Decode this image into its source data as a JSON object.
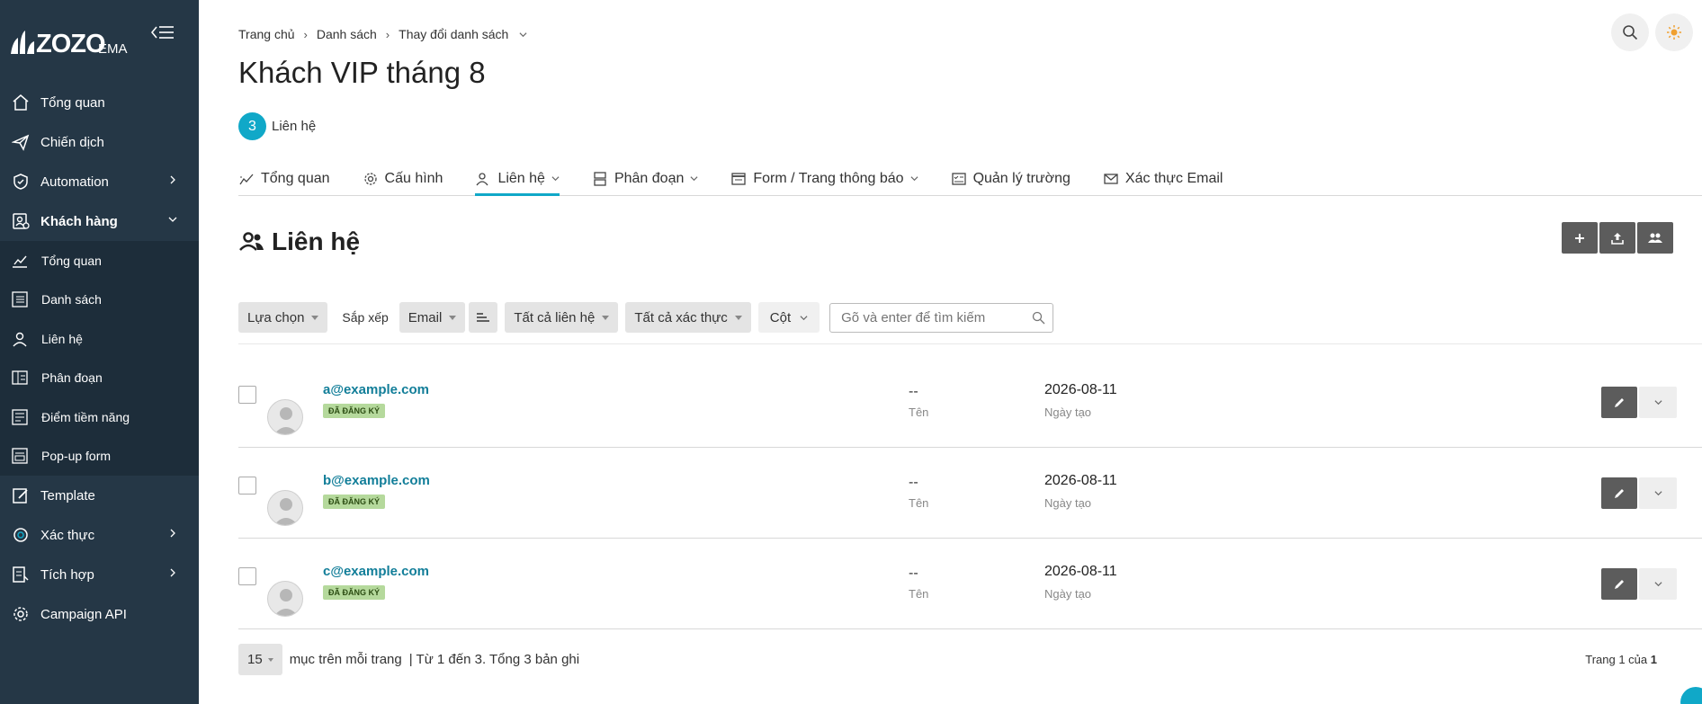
{
  "app": {
    "logo_text": "ZOZO",
    "logo_sub": "EMA"
  },
  "sidebar": {
    "items": [
      {
        "label": "Tổng quan",
        "icon": "home-icon"
      },
      {
        "label": "Chiến dịch",
        "icon": "send-icon"
      },
      {
        "label": "Automation",
        "icon": "shield-check-icon"
      },
      {
        "label": "Khách hàng",
        "icon": "contacts-icon"
      }
    ],
    "sub_items": [
      {
        "label": "Tổng quan",
        "icon": "chart-line-icon"
      },
      {
        "label": "Danh sách",
        "icon": "list-icon"
      },
      {
        "label": "Liên hệ",
        "icon": "user-icon"
      },
      {
        "label": "Phân đoạn",
        "icon": "segment-icon"
      },
      {
        "label": "Điểm tiềm năng",
        "icon": "score-icon"
      },
      {
        "label": "Pop-up form",
        "icon": "form-icon"
      }
    ],
    "bottom_items": [
      {
        "label": "Template",
        "icon": "edit-template-icon"
      },
      {
        "label": "Xác thực",
        "icon": "verify-icon"
      },
      {
        "label": "Tích hợp",
        "icon": "integration-icon"
      },
      {
        "label": "Campaign API",
        "icon": "gear-icon"
      }
    ]
  },
  "breadcrumb": [
    "Trang chủ",
    "Danh sách",
    "Thay đổi danh sách"
  ],
  "page": {
    "title": "Khách VIP tháng 8",
    "count": "3",
    "count_label": "Liên hệ"
  },
  "tabs": [
    {
      "label": "Tổng quan",
      "icon": "chart-line-icon"
    },
    {
      "label": "Cấu hình",
      "icon": "gear-icon"
    },
    {
      "label": "Liên hệ",
      "icon": "user-icon"
    },
    {
      "label": "Phân đoạn",
      "icon": "segment-icon"
    },
    {
      "label": "Form / Trang thông báo",
      "icon": "form-icon"
    },
    {
      "label": "Quản lý trường",
      "icon": "fields-icon"
    },
    {
      "label": "Xác thực Email",
      "icon": "mail-icon"
    }
  ],
  "section": {
    "title": "Liên hệ"
  },
  "toolbar": {
    "choose": "Lựa chọn",
    "sort_label": "Sắp xếp",
    "sort_field": "Email",
    "filter_contacts": "Tất cả liên hệ",
    "filter_verify": "Tất cả xác thực",
    "columns": "Cột",
    "search_placeholder": "Gõ và enter để tìm kiếm"
  },
  "contacts": [
    {
      "email": "a@example.com",
      "status": "ĐÃ ĐĂNG KÝ",
      "name": "--",
      "name_label": "Tên",
      "date": "2026-08-11",
      "date_label": "Ngày tạo"
    },
    {
      "email": "b@example.com",
      "status": "ĐÃ ĐĂNG KÝ",
      "name": "--",
      "name_label": "Tên",
      "date": "2026-08-11",
      "date_label": "Ngày tạo"
    },
    {
      "email": "c@example.com",
      "status": "ĐÃ ĐĂNG KÝ",
      "name": "--",
      "name_label": "Tên",
      "date": "2026-08-11",
      "date_label": "Ngày tạo"
    }
  ],
  "footer": {
    "per_page": "15",
    "per_page_label": "mục trên mỗi trang",
    "range": "| Từ 1 đến 3. Tổng 3 bản ghi",
    "page_prefix": "Trang 1 của",
    "page_total": "1"
  },
  "colors": {
    "sidebar": "#253746",
    "accent": "#10a8c8",
    "link": "#127e99",
    "badge": "#b5d99c"
  }
}
